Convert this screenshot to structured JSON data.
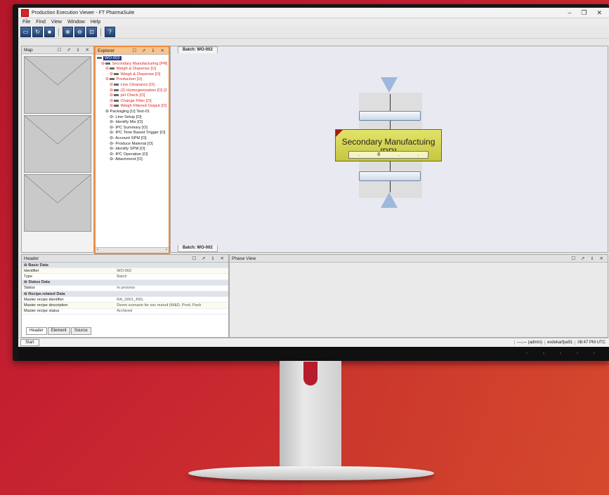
{
  "window": {
    "title": "Production Execution Viewer - FT PharmaSuite",
    "controls": [
      "–",
      "❐",
      "✕"
    ]
  },
  "menu": [
    "File",
    "Find",
    "View",
    "Window",
    "Help"
  ],
  "toolbar": {
    "help_label": "?"
  },
  "panels": {
    "map": {
      "title": "Map",
      "controls": "☐ ⇗ ⇓ ✕"
    },
    "explorer": {
      "title": "Explorer",
      "controls": "☐ ⇗ ⇓ ✕"
    },
    "header": {
      "title": "Header",
      "controls": "☐ ⇗ ⇓ ✕"
    },
    "phase": {
      "title": "Phase View",
      "controls": "☐ ⇗ ⇓ ✕"
    }
  },
  "tree": [
    "WO-002",
    "Secondary Manufacturing [PR]",
    "Weigh & Dispense [U]",
    "Weigh & Dispense [O]",
    "Production [U]",
    "Line Clearance [O]",
    "(2) Homogenization [O] [2",
    "pH Check [O]",
    "Change Filter [O]",
    "Weigh Filtered Output [O]",
    "Packaging [U] Test-01",
    "Line Setup [O]",
    "Identify Mix [O]",
    "IPC Summary [O]",
    "IPC Time Based Trigger [O]",
    "Account SPM [O]",
    "Produce Material [O]",
    "Identify SPM [O]",
    "IPC Operation [O]",
    "Attachment [O]"
  ],
  "editor": {
    "tab_label": "Batch: WO-002",
    "tab_bottom_label": "Batch: WO-002",
    "step_title": "Secondary Manufactuing [PR]",
    "step_sub": [
      ".",
      "8",
      ".",
      "."
    ]
  },
  "properties": {
    "basic": {
      "section": "Basic Data",
      "rows": [
        [
          "Identifier",
          "WO-002"
        ],
        [
          "Type",
          "Batch"
        ]
      ]
    },
    "status": {
      "section": "Status Data",
      "rows": [
        [
          "Status",
          "In process"
        ]
      ]
    },
    "recipe": {
      "section": "Recipe-related Data",
      "rows": [
        [
          "Master recipe identifier",
          "RA_S001_RDL"
        ],
        [
          "Master recipe description",
          "Demo scenario for sec manuf (W&D, Prod, Pack"
        ],
        [
          "Master recipe status",
          "Archived"
        ]
      ]
    }
  },
  "header_tabs": [
    "Header",
    "Element",
    "Source"
  ],
  "status_bar": {
    "start": "Start",
    "items": [
      "—,— (admin)",
      "evdekarfpa91",
      "08:47 PM UTC"
    ]
  },
  "colors": {
    "accent_orange": "#f08a3a",
    "step_yellow": "#d6d650",
    "tree_red": "#e02020",
    "background_red": "#c52030"
  }
}
